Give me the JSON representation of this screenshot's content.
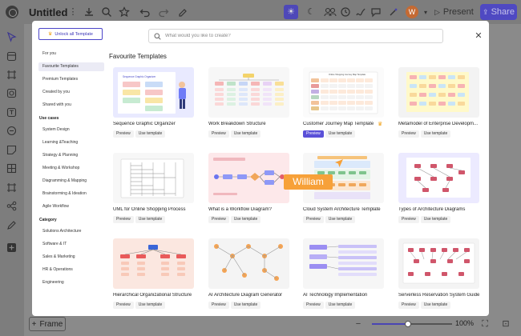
{
  "app": {
    "title": "Untitled",
    "present_label": "Present",
    "share_label": "Share",
    "avatar_initial": "W",
    "frame_label": "Frame",
    "zoom_level": "100%",
    "zoom_fraction": 0.45,
    "accent_color": "#5a50d8"
  },
  "modal": {
    "search_placeholder": "What would you like to create?",
    "unlock_label": "Unlock all Template",
    "close_icon": "close-icon",
    "section_title": "Favourite Templates"
  },
  "sidebar": {
    "top_items": [
      "For you",
      "Favourite Templates",
      "Premium Templates",
      "Created by you",
      "Shared with you"
    ],
    "active_index": 1,
    "use_cases_heading": "Use cases",
    "use_cases": [
      "System Design",
      "Learning &Teaching",
      "Strategy & Planning",
      "Meeting & Workshop",
      "Diagramming & Mapping",
      "Brainstorming & Ideation",
      "Agile Workflow"
    ],
    "category_heading": "Category",
    "categories": [
      "Solutions Architecture",
      "Software & IT",
      "Sales & Marketing",
      "HR & Operations",
      "Engineering"
    ]
  },
  "card_actions": {
    "preview": "Preview",
    "use_template": "Use template"
  },
  "templates": [
    {
      "title": "Sequence Graphic Organizer",
      "thumb": "sequence"
    },
    {
      "title": "Work Breakdown Structure",
      "thumb": "wbs"
    },
    {
      "title": "Customer Journey Map Template",
      "thumb": "journey",
      "premium": true,
      "preview_highlight": true
    },
    {
      "title": "Metamodel of Enterprise Developm...",
      "thumb": "metamodel"
    },
    {
      "title": "UML for Online Shopping Process",
      "thumb": "uml"
    },
    {
      "title": "What is a Workflow Diagram?",
      "thumb": "workflow"
    },
    {
      "title": "Cloud System Architecture Template",
      "thumb": "cloud"
    },
    {
      "title": "Types of Architecture Diagrams",
      "thumb": "types"
    },
    {
      "title": "Hierarchical Organizational Structure",
      "thumb": "org"
    },
    {
      "title": "AI Architecture Diagram Generator",
      "thumb": "ai-arch"
    },
    {
      "title": "AI Technology Implementation",
      "thumb": "ai-tech"
    },
    {
      "title": "Serverless Reservation System Guide",
      "thumb": "serverless"
    }
  ],
  "thumb_text": {
    "sequence": "Sequence Graphic Organizer",
    "journey": "Online Shopping Journey Map Template"
  },
  "collaborator": {
    "name": "William",
    "color": "#f7a139"
  }
}
